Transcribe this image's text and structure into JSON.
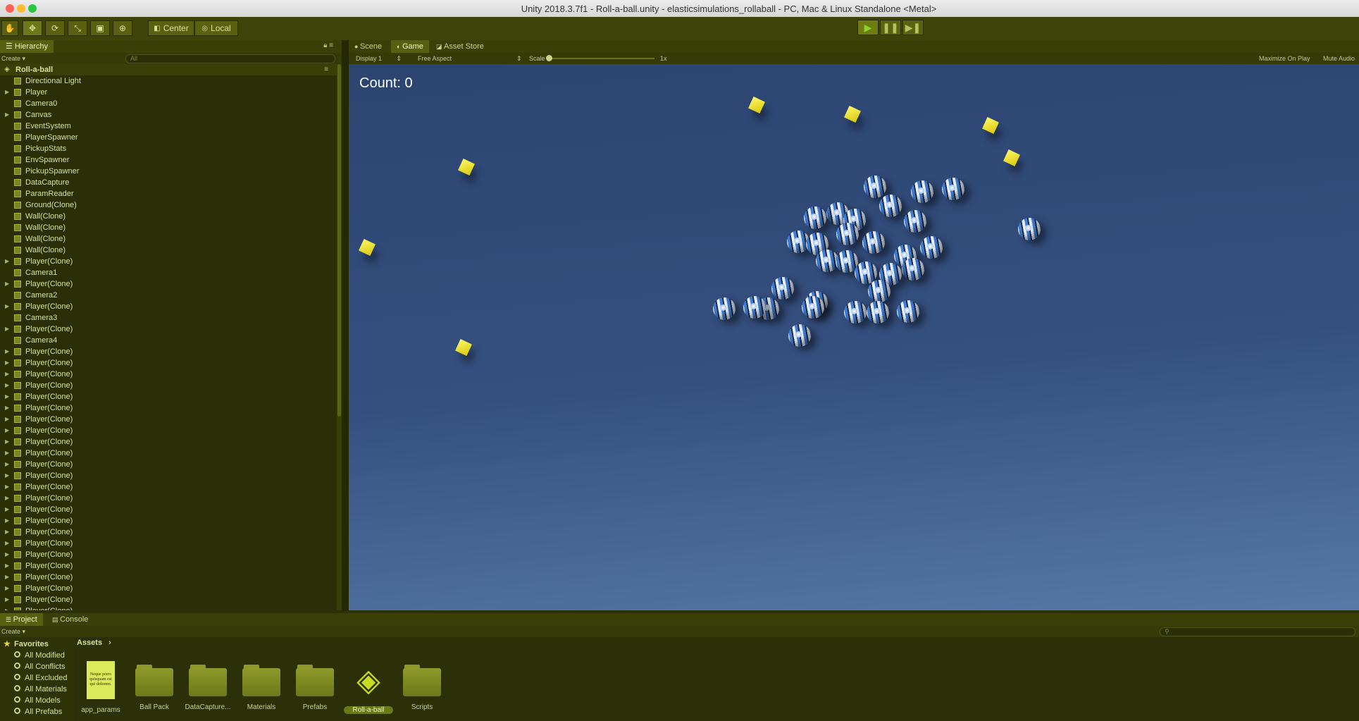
{
  "window": {
    "title": "Unity 2018.3.7f1 - Roll-a-ball.unity - elasticsimulations_rollaball - PC, Mac & Linux Standalone <Metal>"
  },
  "toolbar": {
    "center_label": "Center",
    "local_label": "Local"
  },
  "hierarchy": {
    "tab_label": "Hierarchy",
    "create_label": "Create",
    "search_placeholder": "All",
    "scene_name": "Roll-a-ball",
    "items": [
      {
        "label": "Directional Light",
        "expandable": false
      },
      {
        "label": "Player",
        "expandable": true
      },
      {
        "label": "Camera0",
        "expandable": false
      },
      {
        "label": "Canvas",
        "expandable": true
      },
      {
        "label": "EventSystem",
        "expandable": false
      },
      {
        "label": "PlayerSpawner",
        "expandable": false
      },
      {
        "label": "PickupStats",
        "expandable": false
      },
      {
        "label": "EnvSpawner",
        "expandable": false
      },
      {
        "label": "PickupSpawner",
        "expandable": false
      },
      {
        "label": "DataCapture",
        "expandable": false
      },
      {
        "label": "ParamReader",
        "expandable": false
      },
      {
        "label": "Ground(Clone)",
        "expandable": false
      },
      {
        "label": "Wall(Clone)",
        "expandable": false
      },
      {
        "label": "Wall(Clone)",
        "expandable": false
      },
      {
        "label": "Wall(Clone)",
        "expandable": false
      },
      {
        "label": "Wall(Clone)",
        "expandable": false
      },
      {
        "label": "Player(Clone)",
        "expandable": true
      },
      {
        "label": "Camera1",
        "expandable": false
      },
      {
        "label": "Player(Clone)",
        "expandable": true
      },
      {
        "label": "Camera2",
        "expandable": false
      },
      {
        "label": "Player(Clone)",
        "expandable": true
      },
      {
        "label": "Camera3",
        "expandable": false
      },
      {
        "label": "Player(Clone)",
        "expandable": true
      },
      {
        "label": "Camera4",
        "expandable": false
      },
      {
        "label": "Player(Clone)",
        "expandable": true
      },
      {
        "label": "Player(Clone)",
        "expandable": true
      },
      {
        "label": "Player(Clone)",
        "expandable": true
      },
      {
        "label": "Player(Clone)",
        "expandable": true
      },
      {
        "label": "Player(Clone)",
        "expandable": true
      },
      {
        "label": "Player(Clone)",
        "expandable": true
      },
      {
        "label": "Player(Clone)",
        "expandable": true
      },
      {
        "label": "Player(Clone)",
        "expandable": true
      },
      {
        "label": "Player(Clone)",
        "expandable": true
      },
      {
        "label": "Player(Clone)",
        "expandable": true
      },
      {
        "label": "Player(Clone)",
        "expandable": true
      },
      {
        "label": "Player(Clone)",
        "expandable": true
      },
      {
        "label": "Player(Clone)",
        "expandable": true
      },
      {
        "label": "Player(Clone)",
        "expandable": true
      },
      {
        "label": "Player(Clone)",
        "expandable": true
      },
      {
        "label": "Player(Clone)",
        "expandable": true
      },
      {
        "label": "Player(Clone)",
        "expandable": true
      },
      {
        "label": "Player(Clone)",
        "expandable": true
      },
      {
        "label": "Player(Clone)",
        "expandable": true
      },
      {
        "label": "Player(Clone)",
        "expandable": true
      },
      {
        "label": "Player(Clone)",
        "expandable": true
      },
      {
        "label": "Player(Clone)",
        "expandable": true
      },
      {
        "label": "Player(Clone)",
        "expandable": true
      },
      {
        "label": "Player(Clone)",
        "expandable": true
      }
    ]
  },
  "view_tabs": [
    {
      "label": "Scene",
      "active": false
    },
    {
      "label": "Game",
      "active": true
    },
    {
      "label": "Asset Store",
      "active": false
    }
  ],
  "game_bar": {
    "display": "Display 1",
    "aspect": "Free Aspect",
    "scale_label": "Scale",
    "scale_value": "1x",
    "maximize_on_play": "Maximize On Play",
    "mute_audio": "Mute Audio"
  },
  "game": {
    "count_text": "Count: 0"
  },
  "project": {
    "tabs": [
      {
        "label": "Project",
        "active": true
      },
      {
        "label": "Console",
        "active": false
      }
    ],
    "create_label": "Create",
    "favorites_label": "Favorites",
    "favorites": [
      "All Modified",
      "All Conflicts",
      "All Excluded",
      "All Materials",
      "All Models",
      "All Prefabs"
    ],
    "breadcrumb": "Assets",
    "assets": [
      {
        "label": "app_params",
        "kind": "text-file",
        "thumb_text": "Neque porro quisquam est qui dolorem."
      },
      {
        "label": "Ball Pack",
        "kind": "folder"
      },
      {
        "label": "DataCapture...",
        "kind": "folder"
      },
      {
        "label": "Materials",
        "kind": "folder"
      },
      {
        "label": "Prefabs",
        "kind": "folder"
      },
      {
        "label": "Roll-a-ball",
        "kind": "unity-scene",
        "selected": true
      },
      {
        "label": "Scripts",
        "kind": "folder"
      }
    ]
  },
  "colors": {
    "accent": "#59600f",
    "panel": "#2a2f07",
    "play_green": "#8bd12a"
  }
}
